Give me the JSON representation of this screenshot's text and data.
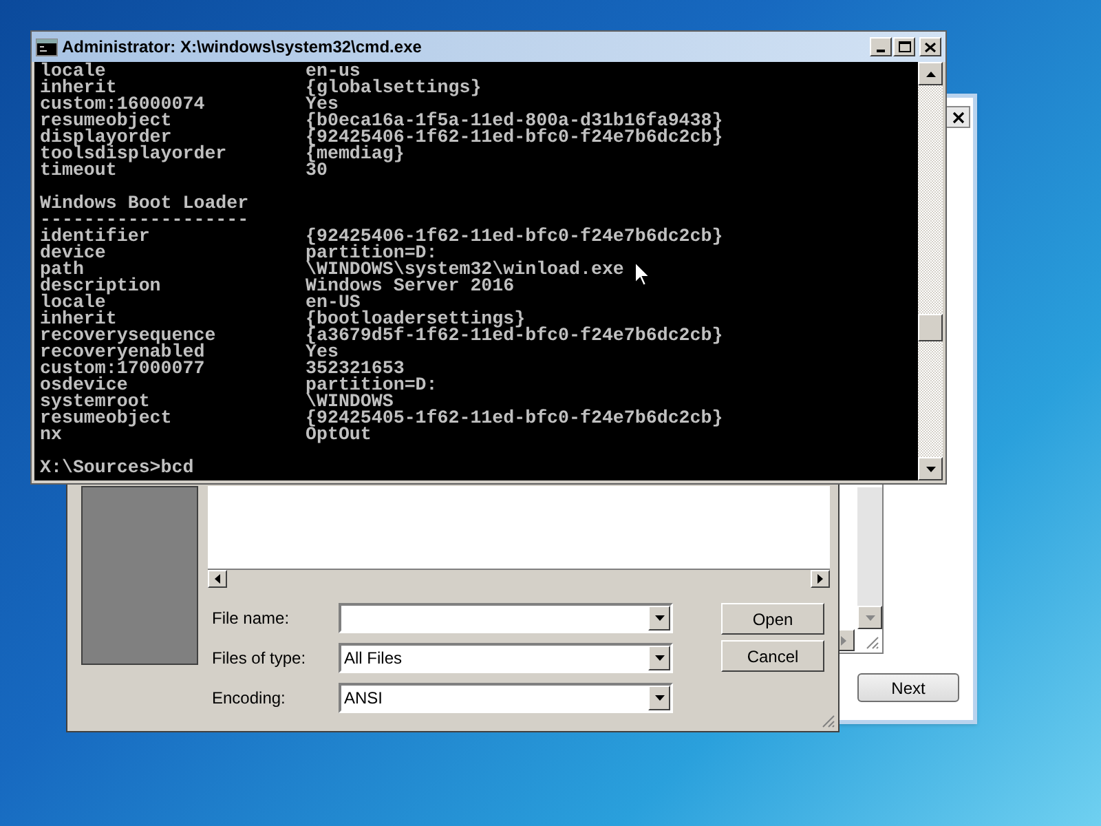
{
  "console": {
    "title": "Administrator: X:\\windows\\system32\\cmd.exe",
    "lines": [
      {
        "kind": "pair",
        "key": "locale",
        "value": "en-us"
      },
      {
        "kind": "pair",
        "key": "inherit",
        "value": "{globalsettings}"
      },
      {
        "kind": "pair",
        "key": "custom:16000074",
        "value": "Yes"
      },
      {
        "kind": "pair",
        "key": "resumeobject",
        "value": "{b0eca16a-1f5a-11ed-800a-d31b16fa9438}"
      },
      {
        "kind": "pair",
        "key": "displayorder",
        "value": "{92425406-1f62-11ed-bfc0-f24e7b6dc2cb}"
      },
      {
        "kind": "pair",
        "key": "toolsdisplayorder",
        "value": "{memdiag}"
      },
      {
        "kind": "pair",
        "key": "timeout",
        "value": "30"
      },
      {
        "kind": "blank"
      },
      {
        "kind": "heading",
        "text": "Windows Boot Loader"
      },
      {
        "kind": "rule",
        "text": "-------------------"
      },
      {
        "kind": "pair",
        "key": "identifier",
        "value": "{92425406-1f62-11ed-bfc0-f24e7b6dc2cb}"
      },
      {
        "kind": "pair",
        "key": "device",
        "value": "partition=D:"
      },
      {
        "kind": "pair",
        "key": "path",
        "value": "\\WINDOWS\\system32\\winload.exe"
      },
      {
        "kind": "pair",
        "key": "description",
        "value": "Windows Server 2016"
      },
      {
        "kind": "pair",
        "key": "locale",
        "value": "en-US"
      },
      {
        "kind": "pair",
        "key": "inherit",
        "value": "{bootloadersettings}"
      },
      {
        "kind": "pair",
        "key": "recoverysequence",
        "value": "{a3679d5f-1f62-11ed-bfc0-f24e7b6dc2cb}"
      },
      {
        "kind": "pair",
        "key": "recoveryenabled",
        "value": "Yes"
      },
      {
        "kind": "pair",
        "key": "custom:17000077",
        "value": "352321653"
      },
      {
        "kind": "pair",
        "key": "osdevice",
        "value": "partition=D:"
      },
      {
        "kind": "pair",
        "key": "systemroot",
        "value": "\\WINDOWS"
      },
      {
        "kind": "pair",
        "key": "resumeobject",
        "value": "{92425405-1f62-11ed-bfc0-f24e7b6dc2cb}"
      },
      {
        "kind": "pair",
        "key": "nx",
        "value": "OptOut"
      },
      {
        "kind": "blank"
      },
      {
        "kind": "prompt",
        "text": "X:\\Sources>bcd"
      }
    ]
  },
  "open_dialog": {
    "fields": [
      {
        "label": "File name:"
      },
      {
        "label": "Files of type:",
        "value": "All Files"
      },
      {
        "label": "Encoding:",
        "value": "ANSI"
      }
    ],
    "buttons": [
      "Open",
      "Cancel"
    ]
  },
  "setup_window": {
    "buttons": [
      "Next"
    ]
  }
}
